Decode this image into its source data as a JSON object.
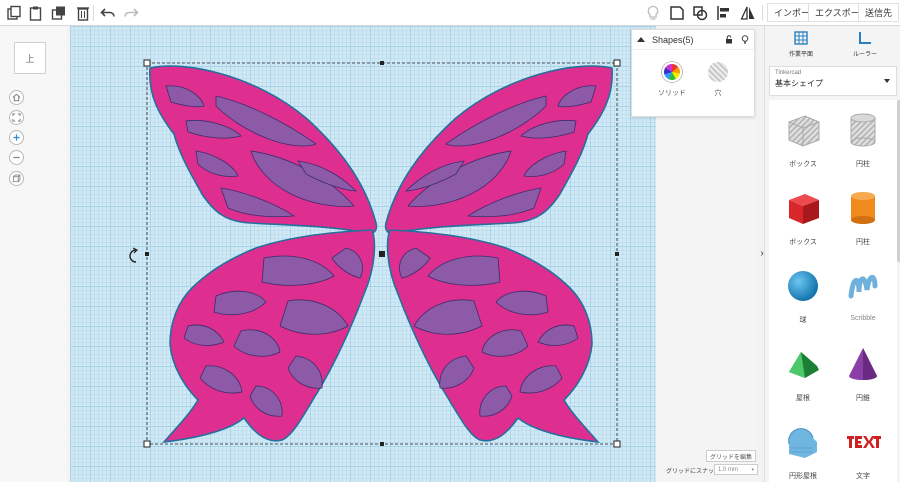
{
  "top_actions": {
    "import": "インポート",
    "export": "エクスポート",
    "send": "送信先"
  },
  "view": {
    "cube_face": "上"
  },
  "shapes_panel": {
    "title": "Shapes(5)",
    "solid_label": "ソリッド",
    "hole_label": "穴"
  },
  "right_tools": {
    "workplane": "作業平面",
    "ruler": "ルーラー"
  },
  "library": {
    "source": "Tinkercad",
    "category": "基本シェイプ",
    "items": [
      {
        "label": "ボックス"
      },
      {
        "label": "円柱"
      },
      {
        "label": "ボックス"
      },
      {
        "label": "円柱"
      },
      {
        "label": "球"
      },
      {
        "label": "Scribble"
      },
      {
        "label": "屋根"
      },
      {
        "label": "円錐"
      },
      {
        "label": "円形屋根"
      },
      {
        "label": "文字"
      }
    ]
  },
  "grid_controls": {
    "edit_grid": "グリッドを編集",
    "snap_label": "グリッドにスナップ",
    "snap_value": "1.0 mm"
  },
  "colors": {
    "wing_pink": "#de2f90",
    "wing_purple": "#8c5aa6",
    "outline": "#24709a",
    "grid": "#cfe9f5",
    "box_red": "#d9262b",
    "cylinder_orange": "#f08a1c",
    "sphere_blue": "#1b8fd0",
    "scribble_blue": "#6fb0dd",
    "roof_green": "#2ba84a",
    "cone_purple": "#8a3fa6",
    "text_red": "#d02020"
  }
}
